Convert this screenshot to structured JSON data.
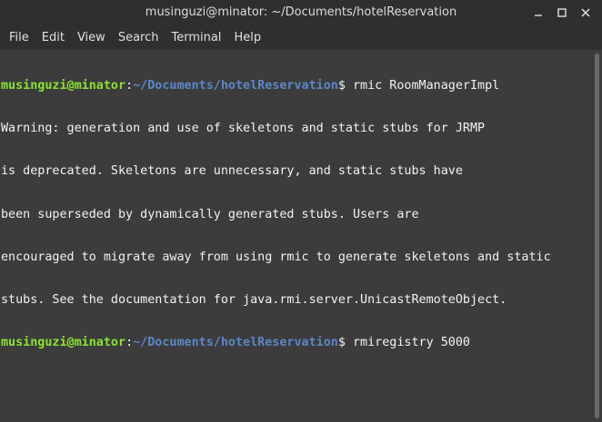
{
  "window": {
    "title": "musinguzi@minator: ~/Documents/hotelReservation",
    "controls": [
      "minimize-icon",
      "maximize-icon",
      "close-icon"
    ]
  },
  "menu": {
    "items": [
      "File",
      "Edit",
      "View",
      "Search",
      "Terminal",
      "Help"
    ]
  },
  "terminal": {
    "prompt_user": "musinguzi@minator",
    "prompt_sep": ":",
    "prompt_path": "~/Documents/hotelReservation",
    "prompt_symbol": "$",
    "command1": " rmic RoomManagerImpl",
    "output": [
      "Warning: generation and use of skeletons and static stubs for JRMP",
      "is deprecated. Skeletons are unnecessary, and static stubs have",
      "been superseded by dynamically generated stubs. Users are",
      "encouraged to migrate away from using rmic to generate skeletons and static",
      "stubs. See the documentation for java.rmi.server.UnicastRemoteObject."
    ],
    "command2": " rmiregistry 5000"
  },
  "colors": {
    "background": "#3c3c3c",
    "titlebar": "#2f2f2f",
    "prompt_user": "#8ae234",
    "prompt_path": "#5c86c8"
  }
}
